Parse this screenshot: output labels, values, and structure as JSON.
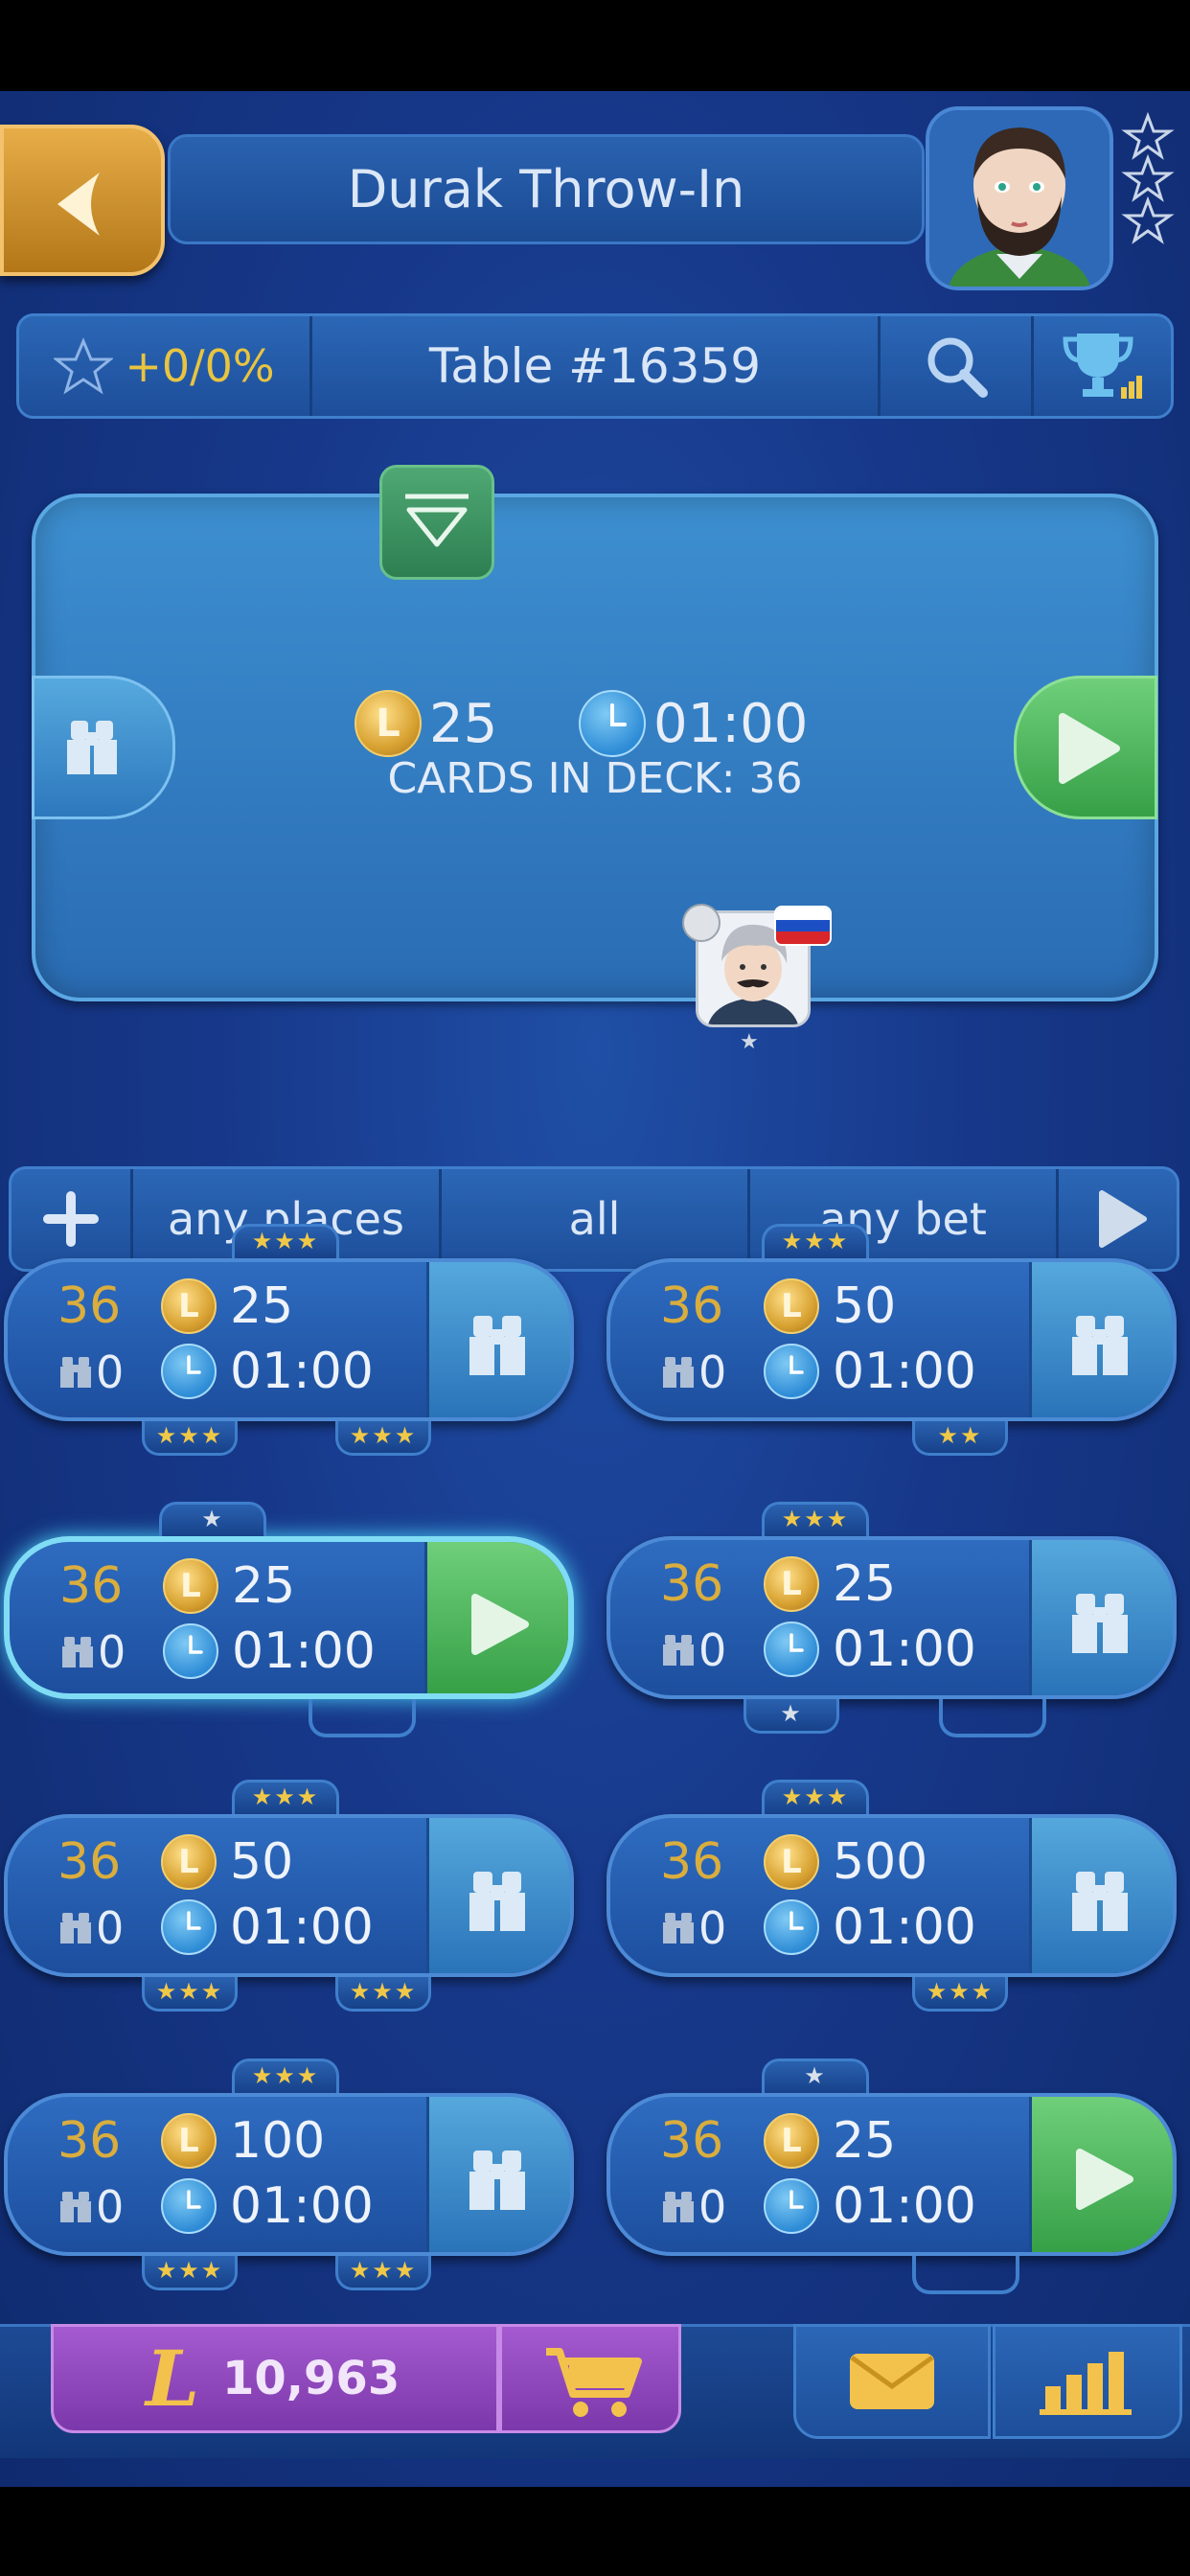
{
  "header": {
    "title": "Durak Throw-In",
    "back_icon": "chevron-left-icon",
    "rank_stars": 3
  },
  "statbar": {
    "score_change": "+0/0%",
    "table_label": "Table #16359",
    "search_icon": "search-icon",
    "trophy_icon": "trophy-icon"
  },
  "table_preview": {
    "bet": "25",
    "time": "01:00",
    "deck_label": "CARDS IN DECK: 36",
    "player_flag": "russia-flag-icon",
    "player_rank_stars": 1
  },
  "filters": {
    "add_icon": "plus-icon",
    "places": "any places",
    "mode": "all",
    "bet": "any bet",
    "next_icon": "play-icon"
  },
  "games": [
    {
      "deck": "36",
      "watchers": "0",
      "bet": "25",
      "time": "01:00",
      "action": "watch",
      "top_seats": [
        "★★★"
      ],
      "bottom_seats": [
        "★★★",
        "★★★"
      ]
    },
    {
      "deck": "36",
      "watchers": "0",
      "bet": "50",
      "time": "01:00",
      "action": "watch",
      "top_seats": [
        "★★★"
      ],
      "bottom_seats": [
        "★★"
      ]
    },
    {
      "deck": "36",
      "watchers": "0",
      "bet": "25",
      "time": "01:00",
      "action": "play",
      "selected": true,
      "top_seats": [
        "★"
      ],
      "bottom_seats": [
        ""
      ]
    },
    {
      "deck": "36",
      "watchers": "0",
      "bet": "25",
      "time": "01:00",
      "action": "watch",
      "top_seats": [
        "★★★"
      ],
      "bottom_seats": [
        "★",
        ""
      ]
    },
    {
      "deck": "36",
      "watchers": "0",
      "bet": "50",
      "time": "01:00",
      "action": "watch",
      "top_seats": [
        "★★★"
      ],
      "bottom_seats": [
        "★★★",
        "★★★"
      ]
    },
    {
      "deck": "36",
      "watchers": "0",
      "bet": "500",
      "time": "01:00",
      "action": "watch",
      "top_seats": [
        "★★★"
      ],
      "bottom_seats": [
        "★★★"
      ]
    },
    {
      "deck": "36",
      "watchers": "0",
      "bet": "100",
      "time": "01:00",
      "action": "watch",
      "top_seats": [
        "★★★"
      ],
      "bottom_seats": [
        "★★★",
        "★★★"
      ]
    },
    {
      "deck": "36",
      "watchers": "0",
      "bet": "25",
      "time": "01:00",
      "action": "play",
      "top_seats": [
        "★"
      ],
      "bottom_seats": [
        ""
      ]
    }
  ],
  "bottombar": {
    "balance": "10,963",
    "currency_icon": "l-coin-icon",
    "cart_icon": "cart-icon",
    "mail_icon": "mail-icon",
    "stats_icon": "bar-chart-icon"
  },
  "colors": {
    "background": "#17388a",
    "gold": "#d9ad3e",
    "play_green": "#36a047",
    "coins_purple": "#8e45bb"
  }
}
